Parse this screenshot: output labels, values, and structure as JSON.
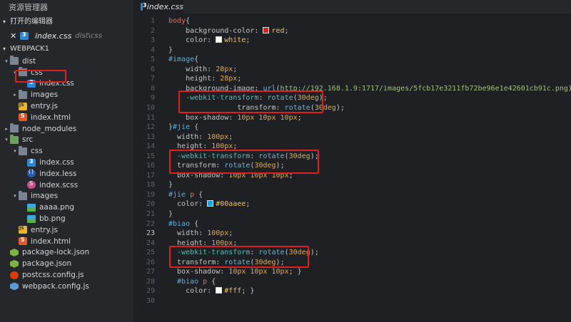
{
  "sidebar": {
    "title": "资源管理器",
    "open_editors_label": "打开的编辑器",
    "open_file": {
      "name": "index.css",
      "path": "dist\\css"
    },
    "workspace_label": "WEBPACK1",
    "tree": [
      {
        "label": "dist",
        "icon": "folder-icon",
        "depth": 0,
        "arrow": "▾"
      },
      {
        "label": "css",
        "icon": "folder-icon",
        "depth": 1,
        "arrow": "▾"
      },
      {
        "label": "index.css",
        "icon": "css-file-icon",
        "depth": 2,
        "arrow": ""
      },
      {
        "label": "images",
        "icon": "folder-icon",
        "depth": 1,
        "arrow": "▸"
      },
      {
        "label": "entry.js",
        "icon": "js-file-icon",
        "depth": 1,
        "arrow": ""
      },
      {
        "label": "index.html",
        "icon": "html-file-icon",
        "depth": 1,
        "arrow": ""
      },
      {
        "label": "node_modules",
        "icon": "folder-icon",
        "depth": 0,
        "arrow": "▸"
      },
      {
        "label": "src",
        "icon": "src-folder-icon",
        "depth": 0,
        "arrow": "▾"
      },
      {
        "label": "css",
        "icon": "folder-icon",
        "depth": 1,
        "arrow": "▾"
      },
      {
        "label": "index.css",
        "icon": "css-file-icon",
        "depth": 2,
        "arrow": ""
      },
      {
        "label": "index.less",
        "icon": "less-file-icon",
        "depth": 2,
        "arrow": ""
      },
      {
        "label": "index.scss",
        "icon": "scss-file-icon",
        "depth": 2,
        "arrow": ""
      },
      {
        "label": "images",
        "icon": "folder-icon",
        "depth": 1,
        "arrow": "▾"
      },
      {
        "label": "aaaa.png",
        "icon": "image-file-icon",
        "depth": 2,
        "arrow": ""
      },
      {
        "label": "bb.png",
        "icon": "image-file-icon",
        "depth": 2,
        "arrow": ""
      },
      {
        "label": "entry.js",
        "icon": "js-file-icon",
        "depth": 1,
        "arrow": ""
      },
      {
        "label": "index.html",
        "icon": "html-file-icon",
        "depth": 1,
        "arrow": ""
      },
      {
        "label": "package-lock.json",
        "icon": "node-json-icon",
        "depth": 0,
        "arrow": ""
      },
      {
        "label": "package.json",
        "icon": "node-json-icon",
        "depth": 0,
        "arrow": ""
      },
      {
        "label": "postcss.config.js",
        "icon": "postcss-icon",
        "depth": 0,
        "arrow": ""
      },
      {
        "label": "webpack.config.js",
        "icon": "webpack-icon",
        "depth": 0,
        "arrow": ""
      }
    ]
  },
  "tab": {
    "label": "index.css"
  },
  "colors": {
    "red": "#e02020",
    "white": "#ffffff",
    "aaee": "#00aaee",
    "fff": "#ffffff"
  },
  "code": [
    {
      "n": "1",
      "tokens": [
        [
          "sel",
          "body"
        ],
        [
          "p",
          "{"
        ]
      ]
    },
    {
      "n": "2",
      "tokens": [
        [
          "p",
          "    background-color: "
        ],
        [
          "sw",
          "red"
        ],
        [
          "val",
          "red"
        ],
        [
          "p",
          ";"
        ]
      ]
    },
    {
      "n": "3",
      "tokens": [
        [
          "p",
          "    color: "
        ],
        [
          "sw",
          "white"
        ],
        [
          "val",
          "white"
        ],
        [
          "p",
          ";"
        ]
      ]
    },
    {
      "n": "4",
      "tokens": [
        [
          "p",
          "}"
        ]
      ]
    },
    {
      "n": "5",
      "tokens": [
        [
          "selb",
          "#image"
        ],
        [
          "p",
          "{"
        ]
      ]
    },
    {
      "n": "6",
      "tokens": [
        [
          "p",
          "    width: "
        ],
        [
          "num",
          "28px"
        ],
        [
          "p",
          ";"
        ]
      ]
    },
    {
      "n": "7",
      "tokens": [
        [
          "p",
          "    height: "
        ],
        [
          "num",
          "28px"
        ],
        [
          "p",
          ";"
        ]
      ]
    },
    {
      "n": "8",
      "tokens": [
        [
          "p",
          "    background-image: "
        ],
        [
          "fn",
          "url"
        ],
        [
          "p",
          "("
        ],
        [
          "str",
          "http://192.168.1.9:1717/images/5fcb17e3211fb72be96e1e42601cb91c.png"
        ],
        [
          "p",
          ");"
        ]
      ]
    },
    {
      "n": "9",
      "tokens": [
        [
          "wk",
          "    -webkit-transform"
        ],
        [
          "p",
          ": "
        ],
        [
          "fn",
          "rotate"
        ],
        [
          "p",
          "("
        ],
        [
          "num",
          "30deg"
        ],
        [
          "p",
          ");"
        ]
      ]
    },
    {
      "n": "10",
      "tokens": [
        [
          "p",
          "                transform: "
        ],
        [
          "fn",
          "rotate"
        ],
        [
          "p",
          "("
        ],
        [
          "num",
          "30deg"
        ],
        [
          "p",
          ");"
        ]
      ]
    },
    {
      "n": "11",
      "tokens": [
        [
          "p",
          "    box-shadow: "
        ],
        [
          "num",
          "10px 10px 10px"
        ],
        [
          "p",
          ";"
        ]
      ]
    },
    {
      "n": "12",
      "tokens": [
        [
          "p",
          "}"
        ],
        [
          "selb",
          "#jie"
        ],
        [
          "p",
          " {"
        ]
      ]
    },
    {
      "n": "13",
      "tokens": [
        [
          "p",
          "  width: "
        ],
        [
          "num",
          "100px"
        ],
        [
          "p",
          ";"
        ]
      ]
    },
    {
      "n": "14",
      "tokens": [
        [
          "p",
          "  height: "
        ],
        [
          "num",
          "100px"
        ],
        [
          "p",
          ";"
        ]
      ]
    },
    {
      "n": "15",
      "tokens": [
        [
          "wk",
          "  -webkit-transform"
        ],
        [
          "p",
          ": "
        ],
        [
          "fn",
          "rotate"
        ],
        [
          "p",
          "("
        ],
        [
          "num",
          "30deg"
        ],
        [
          "p",
          ");"
        ]
      ]
    },
    {
      "n": "16",
      "tokens": [
        [
          "p",
          "  transform: "
        ],
        [
          "fn",
          "rotate"
        ],
        [
          "p",
          "("
        ],
        [
          "num",
          "30deg"
        ],
        [
          "p",
          ");"
        ]
      ]
    },
    {
      "n": "17",
      "tokens": [
        [
          "p",
          "  box-shadow: "
        ],
        [
          "num",
          "10px 10px 10px"
        ],
        [
          "p",
          ";"
        ]
      ]
    },
    {
      "n": "18",
      "tokens": [
        [
          "p",
          "}"
        ]
      ]
    },
    {
      "n": "19",
      "tokens": [
        [
          "selb",
          "#jie"
        ],
        [
          "sel",
          " p"
        ],
        [
          "p",
          " {"
        ]
      ]
    },
    {
      "n": "20",
      "tokens": [
        [
          "p",
          "  color: "
        ],
        [
          "sw",
          "aaee"
        ],
        [
          "val",
          "#00aaee"
        ],
        [
          "p",
          ";"
        ]
      ]
    },
    {
      "n": "21",
      "tokens": [
        [
          "p",
          "}"
        ]
      ]
    },
    {
      "n": "22",
      "tokens": [
        [
          "selb",
          "#biao"
        ],
        [
          "p",
          " {"
        ]
      ]
    },
    {
      "n": "23",
      "tokens": [
        [
          "p",
          "  width: "
        ],
        [
          "num",
          "100px"
        ],
        [
          "p",
          ";"
        ]
      ]
    },
    {
      "n": "24",
      "tokens": [
        [
          "p",
          "  height: "
        ],
        [
          "num",
          "100px"
        ],
        [
          "p",
          ";"
        ]
      ]
    },
    {
      "n": "25",
      "tokens": [
        [
          "wk",
          "  -webkit-transform"
        ],
        [
          "p",
          ": "
        ],
        [
          "fn",
          "rotate"
        ],
        [
          "p",
          "("
        ],
        [
          "num",
          "30deg"
        ],
        [
          "p",
          ");"
        ]
      ]
    },
    {
      "n": "26",
      "tokens": [
        [
          "p",
          "  transform: "
        ],
        [
          "fn",
          "rotate"
        ],
        [
          "p",
          "("
        ],
        [
          "num",
          "30deg"
        ],
        [
          "p",
          ");"
        ]
      ]
    },
    {
      "n": "27",
      "tokens": [
        [
          "p",
          "  box-shadow: "
        ],
        [
          "num",
          "10px 10px 10px"
        ],
        [
          "p",
          "; }"
        ]
      ]
    },
    {
      "n": "28",
      "tokens": [
        [
          "selb",
          "  #biao"
        ],
        [
          "sel",
          " p"
        ],
        [
          "p",
          " {"
        ]
      ]
    },
    {
      "n": "29",
      "tokens": [
        [
          "p",
          "    color: "
        ],
        [
          "sw",
          "fff"
        ],
        [
          "val",
          "#fff"
        ],
        [
          "p",
          "; }"
        ]
      ]
    },
    {
      "n": "30",
      "tokens": []
    }
  ],
  "current_line": "23"
}
